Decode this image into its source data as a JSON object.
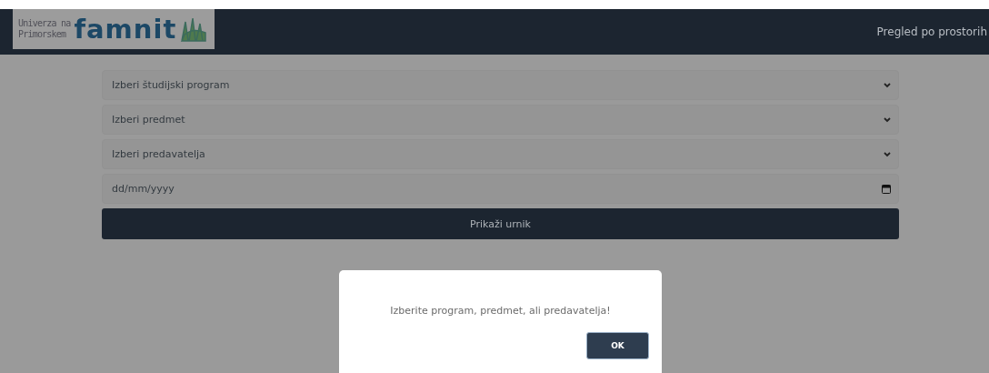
{
  "navbar": {
    "logo": {
      "line_1": "Univerza na",
      "line_2": "Primorskem",
      "wordmark": "famnit"
    },
    "link": "Pregled po prostorih"
  },
  "form": {
    "selects": [
      {
        "placeholder": "Izberi študijski program"
      },
      {
        "placeholder": "Izberi predmet"
      },
      {
        "placeholder": "Izberi predavatelja"
      }
    ],
    "date": {
      "placeholder": "dd/mm/yyyy"
    },
    "submit": "Prikaži urnik"
  },
  "dialog": {
    "message": "Izberite program, predmet, ali predavatelja!",
    "button": "OK"
  }
}
